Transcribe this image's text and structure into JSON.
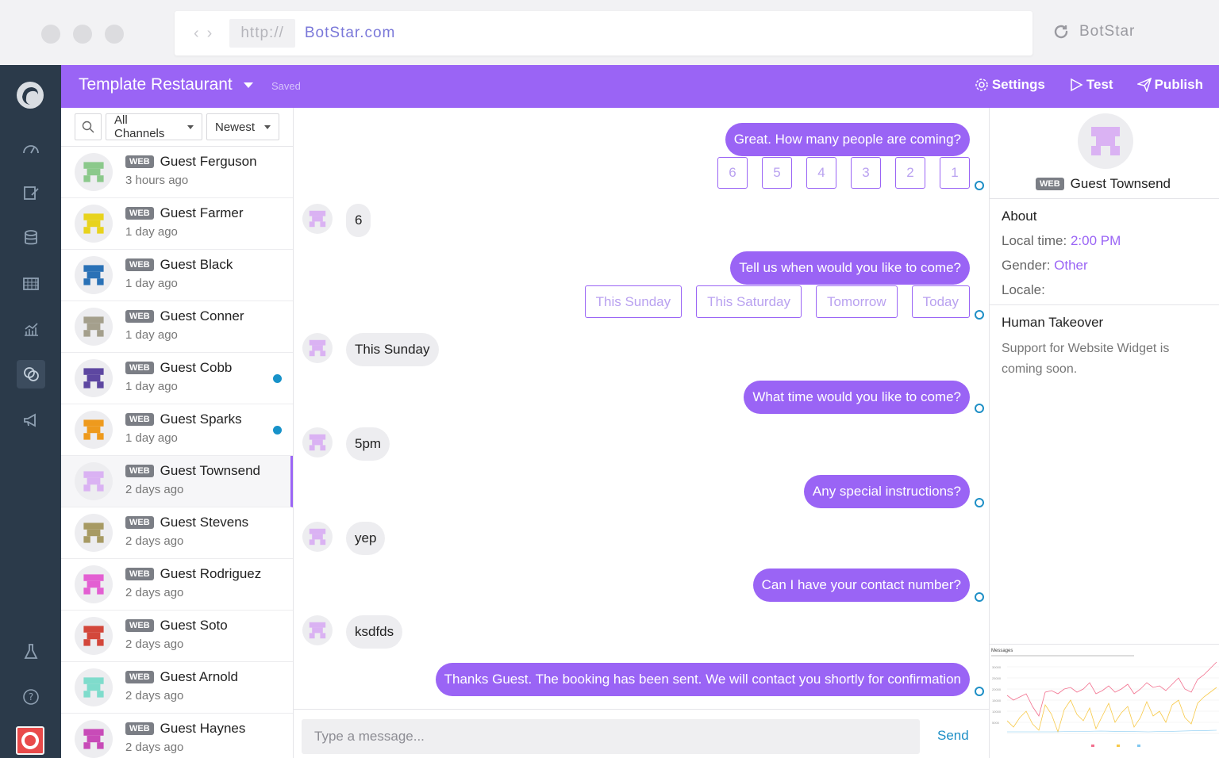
{
  "browser": {
    "protocol": "http://",
    "domain": "BotStar.com",
    "tab_title": "BotStar"
  },
  "topbar": {
    "title": "Template Restaurant",
    "saved": "Saved",
    "settings_label": "Settings",
    "test_label": "Test",
    "publish_label": "Publish",
    "accent": "#9a64f5"
  },
  "filters": {
    "channel": "All Channels",
    "sort": "Newest"
  },
  "conversations": [
    {
      "channel": "WEB",
      "name": "Guest Ferguson",
      "time": "3 hours ago",
      "color": "#8bc98b",
      "unread": false
    },
    {
      "channel": "WEB",
      "name": "Guest Farmer",
      "time": "1 day ago",
      "color": "#e8d31d",
      "unread": false
    },
    {
      "channel": "WEB",
      "name": "Guest Black",
      "time": "1 day ago",
      "color": "#2a71b6",
      "unread": false
    },
    {
      "channel": "WEB",
      "name": "Guest Conner",
      "time": "1 day ago",
      "color": "#a49f8c",
      "unread": false
    },
    {
      "channel": "WEB",
      "name": "Guest Cobb",
      "time": "1 day ago",
      "color": "#5d47a1",
      "unread": true
    },
    {
      "channel": "WEB",
      "name": "Guest Sparks",
      "time": "1 day ago",
      "color": "#ee9a1d",
      "unread": true
    },
    {
      "channel": "WEB",
      "name": "Guest Townsend",
      "time": "2 days ago",
      "color": "#dab2f3",
      "unread": false,
      "active": true
    },
    {
      "channel": "WEB",
      "name": "Guest Stevens",
      "time": "2 days ago",
      "color": "#a79a63",
      "unread": false
    },
    {
      "channel": "WEB",
      "name": "Guest Rodriguez",
      "time": "2 days ago",
      "color": "#e35fd2",
      "unread": false
    },
    {
      "channel": "WEB",
      "name": "Guest Soto",
      "time": "2 days ago",
      "color": "#d3473b",
      "unread": false
    },
    {
      "channel": "WEB",
      "name": "Guest Arnold",
      "time": "2 days ago",
      "color": "#7fdccc",
      "unread": false
    },
    {
      "channel": "WEB",
      "name": "Guest Haynes",
      "time": "2 days ago",
      "color": "#c84bb8",
      "unread": false
    }
  ],
  "chat": {
    "q1": "Great. How many people are coming?",
    "q1_options": [
      "6",
      "5",
      "4",
      "3",
      "2",
      "1"
    ],
    "a1": "6",
    "q2": "Tell us when would you like to come?",
    "q2_options": [
      "This Sunday",
      "This Saturday",
      "Tomorrow",
      "Today"
    ],
    "a2": "This Sunday",
    "q3": "What time would you like to come?",
    "a3": "5pm",
    "q4": "Any special instructions?",
    "a4": "yep",
    "q5": "Can I have your contact number?",
    "a5": "ksdfds",
    "q6": "Thanks Guest. The booking has been sent. We will contact you shortly for confirmation",
    "placeholder": "Type a message...",
    "send_label": "Send"
  },
  "profile": {
    "channel": "WEB",
    "name": "Guest Townsend",
    "about_heading": "About",
    "local_time_label": "Local time: ",
    "local_time": "2:00 PM",
    "gender_label": "Gender: ",
    "gender": "Other",
    "locale_label": "Locale:",
    "takeover_heading": "Human Takeover",
    "takeover_note": "Support for Website Widget is coming soon."
  },
  "thumbnail": {
    "title": "Messages"
  }
}
